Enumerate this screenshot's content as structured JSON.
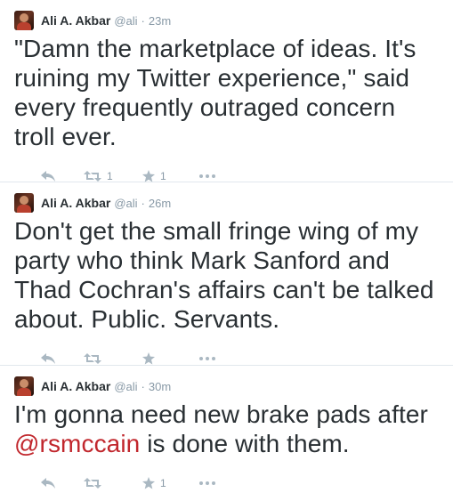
{
  "tweets": [
    {
      "name": "Ali A. Akbar",
      "handle": "@ali",
      "sep": "·",
      "time": "23m",
      "text": "\"Damn the marketplace of ideas. It's ruining my Twitter experience,\" said every frequently outraged concern troll ever.",
      "retweets": "1",
      "favorites": "1"
    },
    {
      "name": "Ali A. Akbar",
      "handle": "@ali",
      "sep": "·",
      "time": "26m",
      "text": "Don't get the small fringe wing of my party who think Mark Sanford and Thad Cochran's affairs can't be talked about. Public. Servants.",
      "retweets": "",
      "favorites": ""
    },
    {
      "name": "Ali A. Akbar",
      "handle": "@ali",
      "sep": "·",
      "time": "30m",
      "text_before": "I'm gonna need new brake pads after ",
      "mention": "@rsmccain",
      "text_after": " is done with them.",
      "retweets": "",
      "favorites": "1"
    }
  ],
  "icons": {
    "reply": "reply-arrow-icon",
    "retweet": "retweet-icon",
    "favorite": "star-icon",
    "more": "ellipsis-icon"
  },
  "colors": {
    "text": "#292f33",
    "muted": "#8899a6",
    "icon": "#aab8c2",
    "mention": "#c1272d",
    "divider": "#e1e8ed"
  }
}
